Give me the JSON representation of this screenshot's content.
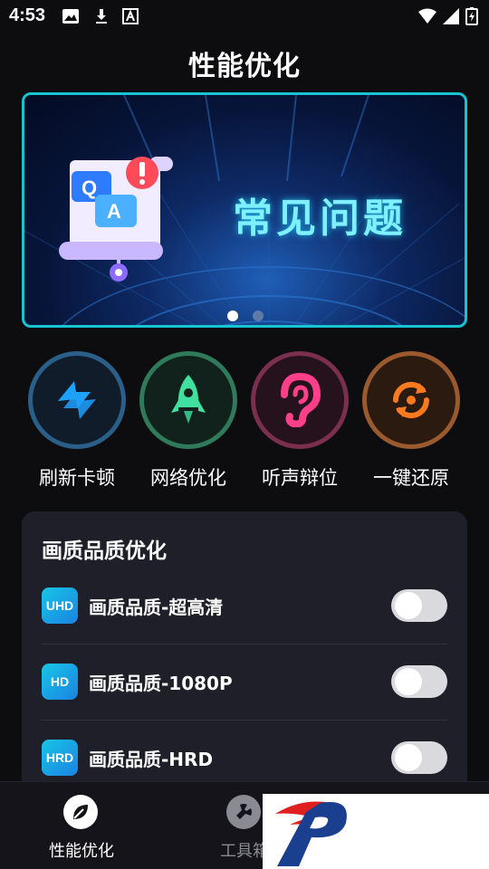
{
  "status_bar": {
    "time": "4:53"
  },
  "header": {
    "title": "性能优化"
  },
  "banner": {
    "text": "常见问题",
    "icon_letters": {
      "q": "Q",
      "a": "A"
    },
    "active_page": 1,
    "page_count": 2
  },
  "features": [
    {
      "label": "刷新卡顿",
      "icon": "refresh-icon",
      "ring_color": "#2a5f8a"
    },
    {
      "label": "网络优化",
      "icon": "rocket-icon",
      "ring_color": "#2f7a5a"
    },
    {
      "label": "听声辩位",
      "icon": "ear-icon",
      "ring_color": "#7a2f4f"
    },
    {
      "label": "一键还原",
      "icon": "restore-icon",
      "ring_color": "#9a5a2e"
    }
  ],
  "quality_card": {
    "title": "画质品质优化",
    "options": [
      {
        "badge": "UHD",
        "label": "画质品质-超高清",
        "enabled": false
      },
      {
        "badge": "HD",
        "label": "画质品质-1080P",
        "enabled": false
      },
      {
        "badge": "HRD",
        "label": "画质品质-HRD",
        "enabled": false
      }
    ]
  },
  "bottom_nav": {
    "items": [
      {
        "label": "性能优化",
        "icon": "leaf-icon",
        "active": true
      },
      {
        "label": "工具箱",
        "icon": "wrench-icon",
        "active": false
      }
    ]
  },
  "colors": {
    "accent": "#16c3cf",
    "background": "#0d0d10",
    "card": "#1f1f29",
    "badge": "#18c6e6"
  }
}
